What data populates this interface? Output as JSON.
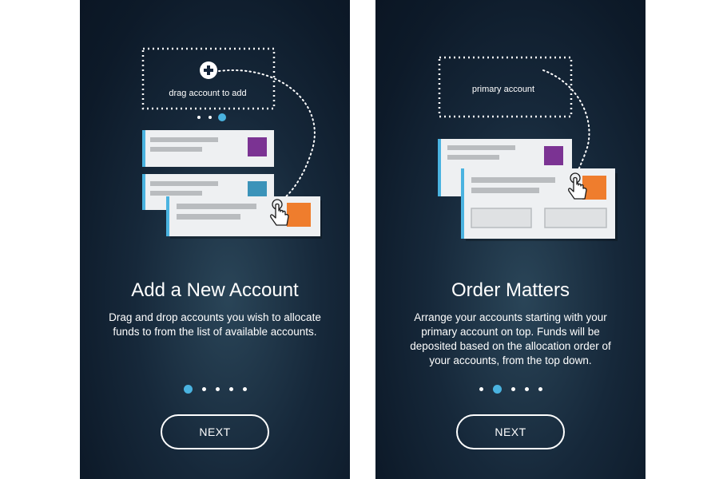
{
  "screens": [
    {
      "drop_zone_label": "drag account to add",
      "title": "Add a New Account",
      "description": "Drag and drop accounts you wish to allocate funds to from the list of available accounts.",
      "pager_active_index": 0,
      "next_label": "NEXT"
    },
    {
      "drop_zone_label": "primary account",
      "title": "Order Matters",
      "description": "Arrange your accounts starting with your primary account on top. Funds will be deposited based on the allocation order of your accounts, from the top down.",
      "pager_active_index": 1,
      "next_label": "NEXT"
    }
  ],
  "colors": {
    "accent_blue": "#4ab3e0",
    "card_purple": "#7b3393",
    "card_blue": "#3b93b9",
    "card_orange": "#ef7d2d"
  },
  "icons": [
    "plus-icon",
    "hand-pointer-icon"
  ]
}
